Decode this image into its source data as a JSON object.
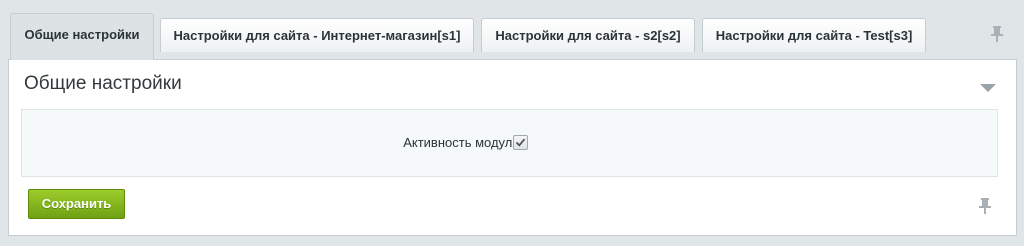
{
  "tabs": [
    {
      "label": "Общие настройки",
      "active": true
    },
    {
      "label": "Настройки для сайта - Интернет-магазин[s1]",
      "active": false
    },
    {
      "label": "Настройки для сайта - s2[s2]",
      "active": false
    },
    {
      "label": "Настройки для сайта - Test[s3]",
      "active": false
    }
  ],
  "panel": {
    "title": "Общие настройки"
  },
  "fields": {
    "module_active": {
      "label": "Активность модуля:",
      "checked": true
    }
  },
  "actions": {
    "save_label": "Сохранить"
  },
  "icons": {
    "pin": "pin-icon",
    "collapse": "collapse-arrow-icon",
    "check": "checkmark-icon"
  },
  "colors": {
    "save_button": "#7fb31a",
    "background": "#e0e5e7"
  }
}
